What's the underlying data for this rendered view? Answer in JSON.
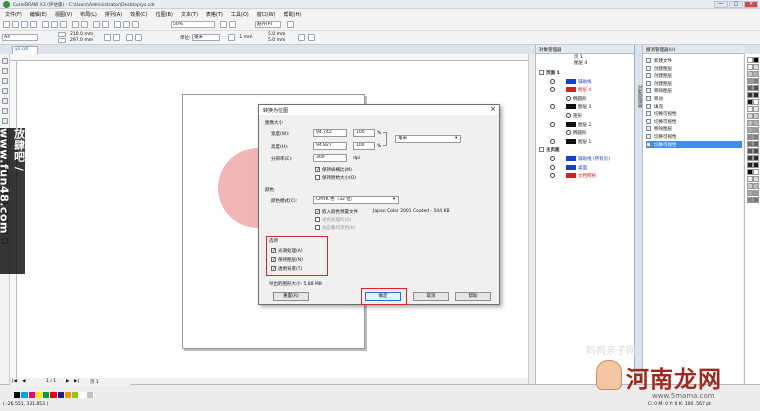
{
  "app": {
    "title": "CorelDRAW X3 (评估版) - C:\\Users\\Administrator\\Desktop\\ys.cdr",
    "window_buttons": [
      "—",
      "□",
      "×"
    ]
  },
  "menu": [
    "文件(F)",
    "编辑(E)",
    "视图(V)",
    "布局(L)",
    "排列(A)",
    "效果(C)",
    "位图(B)",
    "文本(T)",
    "表格(T)",
    "工具(O)",
    "窗口(W)",
    "帮助(H)"
  ],
  "toolbar": {
    "zoom": "50%",
    "snap": "贴齐(P)"
  },
  "propbar": {
    "page_size": "A4",
    "width": "210.0 mm",
    "height": "297.0 mm",
    "units_label": "单位:",
    "units_value": "毫米",
    "nudge": ".1 mm",
    "dup_x": "5.0 mm",
    "dup_y": "5.0 mm"
  },
  "doc_tab": "ys.cdr",
  "watermark_vertical": "放肆吧 / www.fun48.com",
  "object_manager": {
    "title": "对象管理器",
    "header_items": [
      "页 1",
      "图层 4"
    ],
    "side_tab": "对象管理器",
    "rows": [
      {
        "label": "页面 1",
        "type": "page"
      },
      {
        "label": "辅助线",
        "type": "layer",
        "swatch": "#1a3fbf"
      },
      {
        "label": "图层 4",
        "type": "layer",
        "swatch": "#d0221f",
        "color": "#d0221f"
      },
      {
        "label": "椭圆形",
        "type": "item"
      },
      {
        "label": "图层 3",
        "type": "layer",
        "swatch": "#111111"
      },
      {
        "label": "矩形",
        "type": "item"
      },
      {
        "label": "图层 2",
        "type": "layer",
        "swatch": "#111111"
      },
      {
        "label": "椭圆形",
        "type": "item"
      },
      {
        "label": "图层 1",
        "type": "layer",
        "swatch": "#111111"
      },
      {
        "label": "主页面",
        "type": "page"
      },
      {
        "label": "辅助线 (所有页)",
        "type": "layer",
        "swatch": "#1a3fbf"
      },
      {
        "label": "桌面",
        "type": "layer",
        "swatch": "#1a3fbf"
      },
      {
        "label": "文档网格",
        "type": "layer",
        "swatch": "#d0221f",
        "color": "#d0221f"
      }
    ]
  },
  "history": {
    "title": "撤消管理器(U)",
    "items": [
      "新建文件",
      "创建图层",
      "创建图层",
      "创建图层",
      "移除图层",
      "移动",
      "填充",
      "切换可视性",
      "切换可视性",
      "移除图层",
      "切换可视性",
      "切换可视性"
    ],
    "selected_index": 11
  },
  "dialog": {
    "title": "转换为位图",
    "close": "×",
    "size_group": "图像大小",
    "width_label": "宽度(W):",
    "width_value": "94.742",
    "width_pct": "100",
    "height_label": "高度(H):",
    "height_value": "94.827",
    "height_pct": "100",
    "pct_unit": "%",
    "unit_select": "毫米",
    "res_label": "分辨率(E):",
    "res_value": "300",
    "res_unit": "dpi",
    "keep_ratio": "保持纵横比(M)",
    "keep_original": "保持原始大小(O)",
    "color_group": "颜色",
    "color_mode_label": "颜色模式(C):",
    "color_mode_value": "CMYK 色（32 位）",
    "embed_profile": "嵌入颜色预置文件",
    "profile_name": "Japan Color 2001 Coated - 544 KB",
    "apply_icc": "递色处理的(D)",
    "always_overprint": "总是叠印黑色(K)",
    "options_group": "选项",
    "antialias": "光滑处理(A)",
    "keep_layers": "保持图层(N)",
    "transparent_bg": "透明背景(T)",
    "export_size": "导出的图形大小: 5.88 MB",
    "reset_btn": "重置(R)",
    "ok_btn": "确定",
    "cancel_btn": "取消",
    "help_btn": "帮助"
  },
  "statusbar": {
    "page_nav": "1 / 1",
    "page_tab": "页 1",
    "coords": "( -26.551, 331.853 )",
    "fill_info": "C: 0 M: 0 Y: 0 K: 100 .567 pt"
  },
  "brand": {
    "name": "河南龙网",
    "url": "www.5mama.com"
  },
  "faint_wm": "妈妈亲子网",
  "palette_colors": [
    "#ffffff",
    "#000000",
    "#f5f5f5",
    "#e0e0e0",
    "#c8c8c8",
    "#b0b0b0",
    "#989898",
    "#808080",
    "#686868",
    "#505050",
    "#383838",
    "#282828",
    "#1a1a1a",
    "#ffffff",
    "#f2f2f2",
    "#e6e6e6",
    "#d9d9d9",
    "#cccccc",
    "#bfbfbf",
    "#b3b3b3",
    "#a6a6a6",
    "#999999",
    "#8c8c8c",
    "#808080",
    "#737373",
    "#666666",
    "#595959",
    "#4d4d4d",
    "#404040",
    "#333333",
    "#262626",
    "#1a1a1a",
    "#0d0d0d",
    "#ffffff",
    "#eeeeee",
    "#dddddd",
    "#cccccc",
    "#bbbbbb",
    "#aaaaaa",
    "#999999",
    "#888888",
    "#777777"
  ],
  "strip_colors": [
    "#000000",
    "#00a0e9",
    "#e4007f",
    "#fff100",
    "#009944",
    "#e60012",
    "#1d2088",
    "#f39800",
    "#8fc31f",
    "#ffffff",
    "#c0c0c0"
  ]
}
